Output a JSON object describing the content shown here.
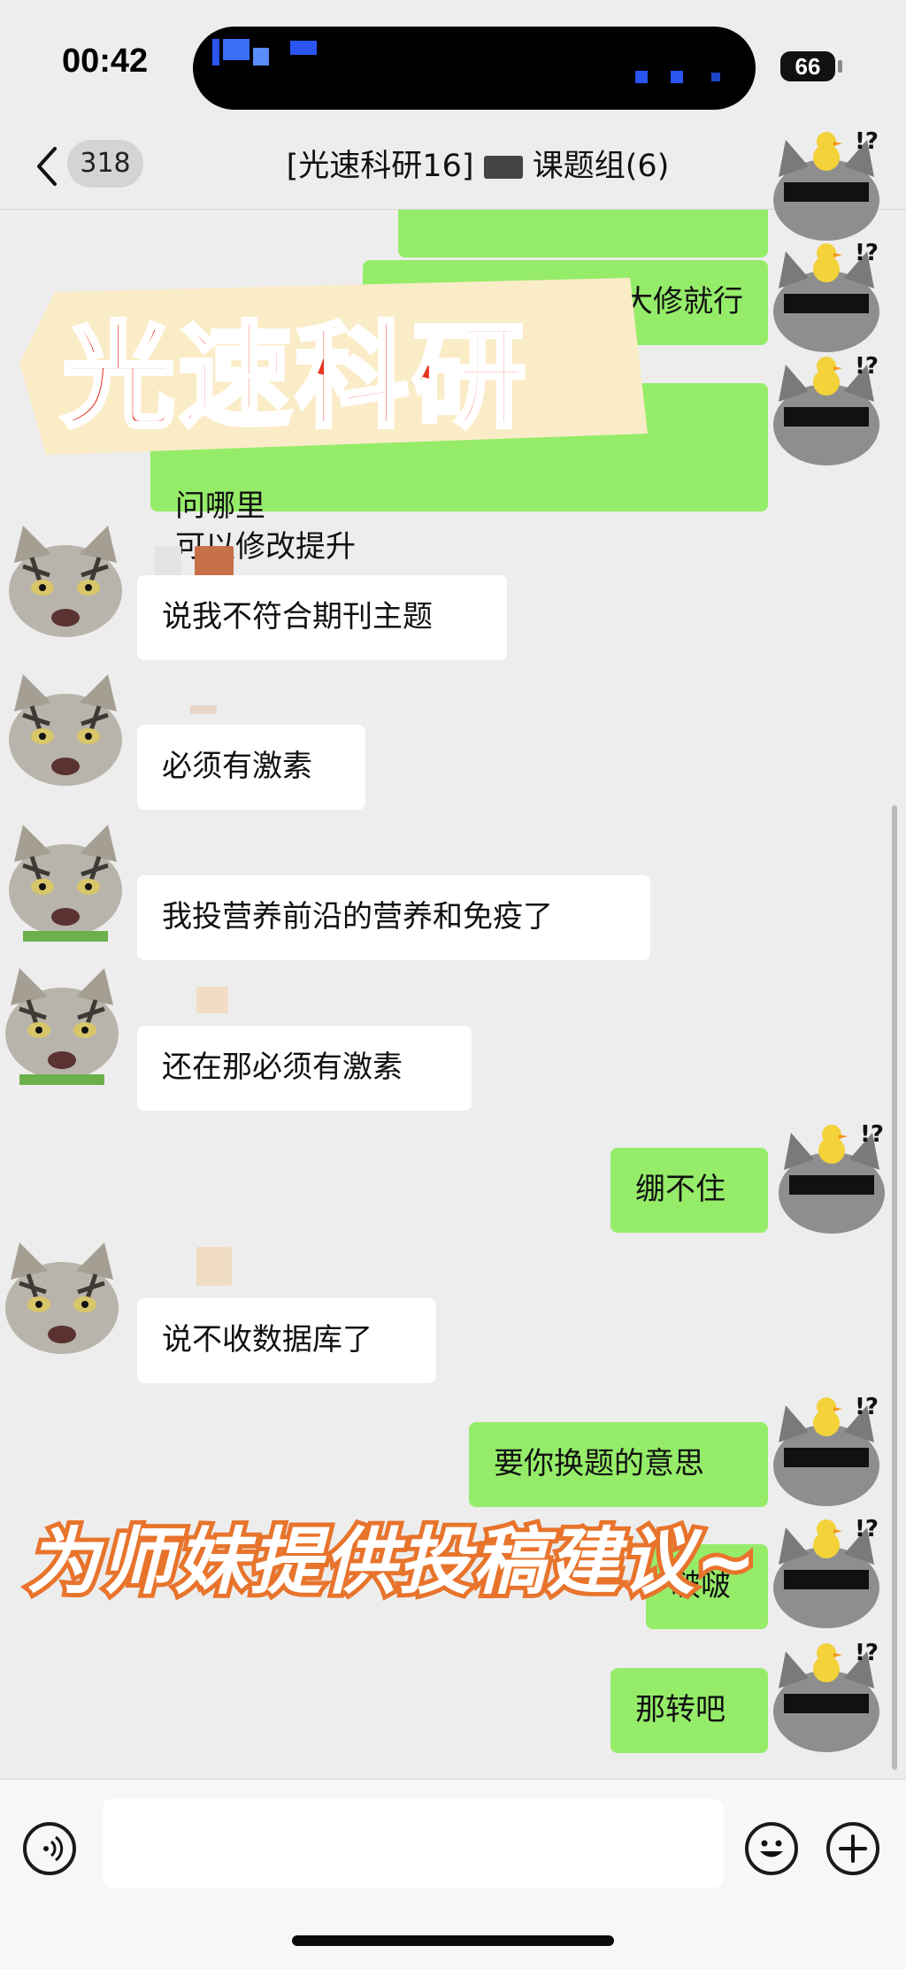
{
  "status_bar": {
    "time": "00:42",
    "battery": "66"
  },
  "nav": {
    "back_count": "318",
    "title_prefix": "[光速科研16]",
    "title_suffix": "课题组(6)"
  },
  "messages": [
    {
      "side": "out",
      "text": "大修就行"
    },
    {
      "side": "out",
      "text": "问哪里\n可以修改提升"
    },
    {
      "side": "in",
      "text": "说我不符合期刊主题"
    },
    {
      "side": "in",
      "text": "必须有激素"
    },
    {
      "side": "in",
      "text": "我投营养前沿的营养和免疫了"
    },
    {
      "side": "in",
      "text": "还在那必须有激素"
    },
    {
      "side": "out",
      "text": "绷不住"
    },
    {
      "side": "in",
      "text": "说不收数据库了"
    },
    {
      "side": "out",
      "text": "要你换题的意思"
    },
    {
      "side": "out",
      "text": "啵啵"
    },
    {
      "side": "out",
      "text": "那转吧"
    }
  ],
  "overlay": {
    "banner": "光速科研",
    "caption": "为师妹提供投稿建议~"
  },
  "avatar_mark": "!?",
  "input": {
    "placeholder": ""
  },
  "colors": {
    "outgoing": "#95ec69",
    "incoming": "#ffffff",
    "background": "#ededed",
    "banner": "#e8321e"
  }
}
